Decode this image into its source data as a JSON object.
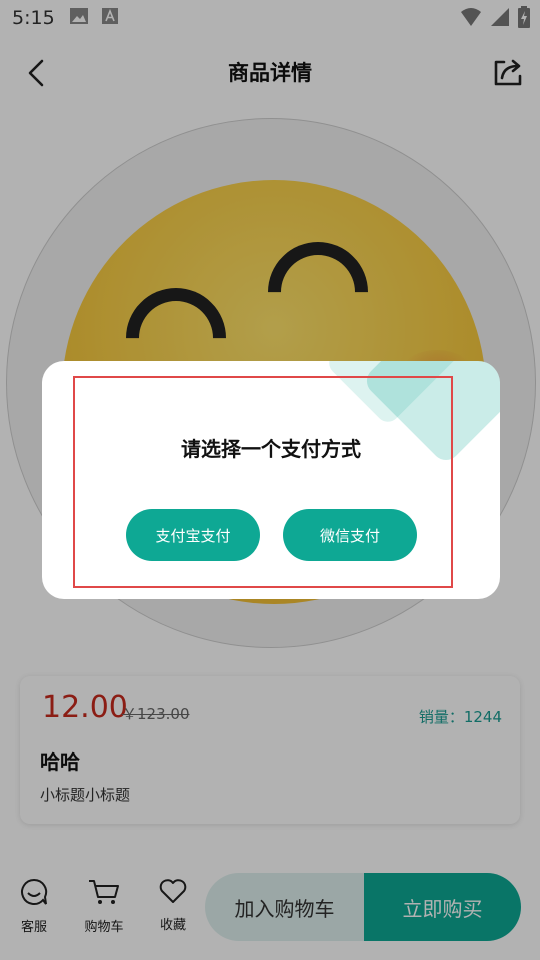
{
  "status_bar": {
    "time": "5:15"
  },
  "nav": {
    "title": "商品详情"
  },
  "product": {
    "price": "12.00",
    "original_price": "￥123.00",
    "sales": "销量：1244",
    "name": "哈哈",
    "subtitle": "小标题小标题"
  },
  "bottom_bar": {
    "service": "客服",
    "cart": "购物车",
    "favorite": "收藏",
    "add_to_cart": "加入购物车",
    "buy_now": "立即购买"
  },
  "dialog": {
    "title": "请选择一个支付方式",
    "alipay": "支付宝支付",
    "wechat": "微信支付"
  },
  "colors": {
    "accent": "#0ea894",
    "price": "#c82a1e",
    "highlight": "#e04848"
  }
}
